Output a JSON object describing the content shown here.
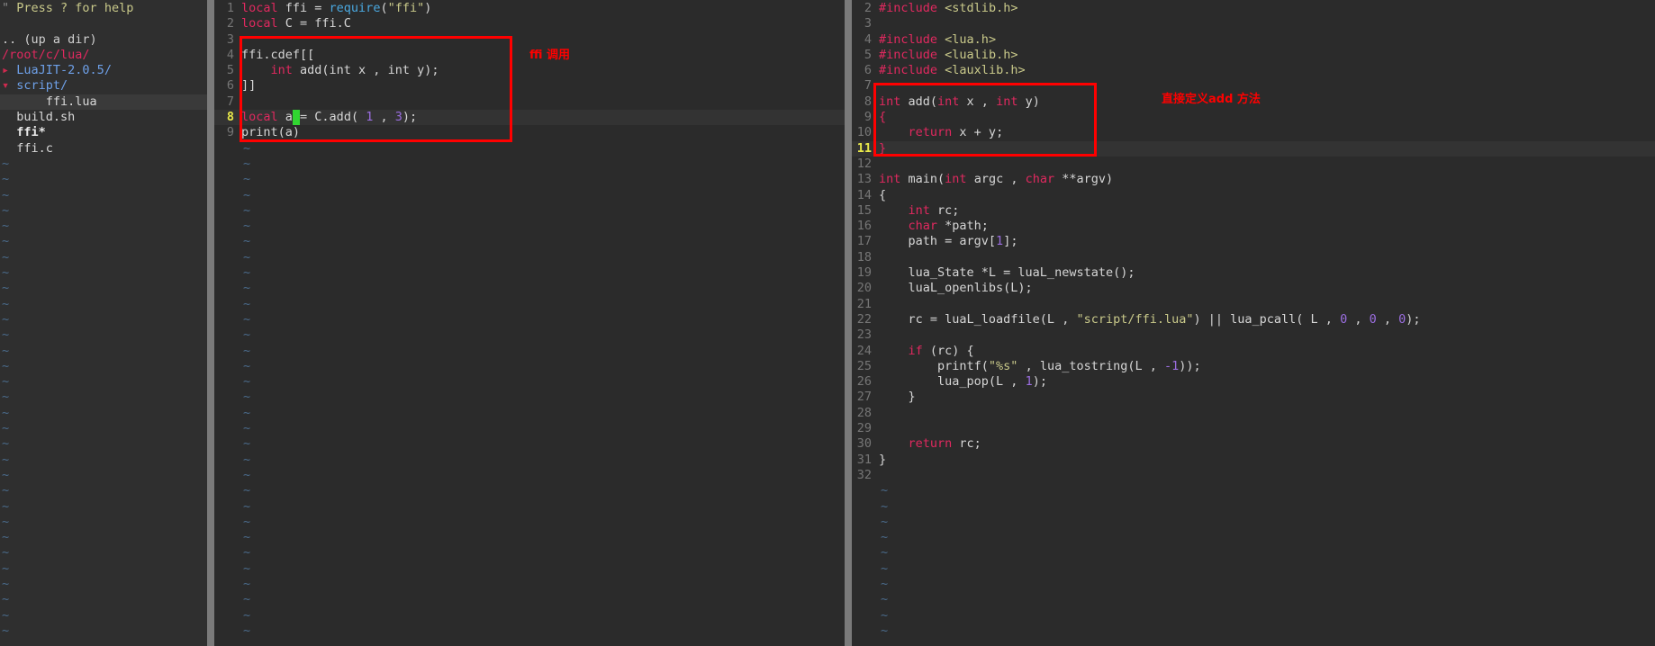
{
  "window": {
    "background": "#2b2b2b",
    "accent_red": "#ff0000"
  },
  "sidebar": {
    "name": "nerdtree-file-explorer",
    "help_prefix": "\"",
    "help_text": "Press ? for help",
    "up_dir": ".. (up a dir)",
    "cwd_path": "/root/c/lua/",
    "items": [
      {
        "indent": 0,
        "arrow": "▸",
        "label": "LuaJIT-2.0.5/",
        "type": "dir-closed",
        "selected": false
      },
      {
        "indent": 0,
        "arrow": "▾",
        "label": "script/",
        "type": "dir-open",
        "selected": false
      },
      {
        "indent": 1,
        "arrow": "",
        "label": "ffi.lua",
        "type": "file",
        "selected": true
      },
      {
        "indent": 0,
        "arrow": "",
        "label": "build.sh",
        "type": "file",
        "selected": false
      },
      {
        "indent": 0,
        "arrow": "",
        "label": "ffi*",
        "type": "executable",
        "selected": false
      },
      {
        "indent": 0,
        "arrow": "",
        "label": "ffi.c",
        "type": "file",
        "selected": false
      }
    ],
    "tilde": "~"
  },
  "left_pane": {
    "name": "ffi-lua-editor",
    "cursor_line": 8,
    "lines": [
      {
        "n": 1,
        "tokens": [
          {
            "t": "local",
            "c": "kw"
          },
          {
            "t": " ffi = ",
            "c": "pl"
          },
          {
            "t": "require",
            "c": "fn"
          },
          {
            "t": "(",
            "c": "pl"
          },
          {
            "t": "\"ffi\"",
            "c": "str"
          },
          {
            "t": ")",
            "c": "pl"
          }
        ]
      },
      {
        "n": 2,
        "tokens": [
          {
            "t": "local",
            "c": "kw"
          },
          {
            "t": " C = ffi.C",
            "c": "pl"
          }
        ]
      },
      {
        "n": 3,
        "tokens": []
      },
      {
        "n": 4,
        "tokens": [
          {
            "t": "ffi.cdef[[",
            "c": "pl"
          }
        ]
      },
      {
        "n": 5,
        "tokens": [
          {
            "t": "    ",
            "c": "pl"
          },
          {
            "t": "int",
            "c": "kw"
          },
          {
            "t": " add(int x , int y);",
            "c": "pl"
          }
        ]
      },
      {
        "n": 6,
        "tokens": [
          {
            "t": "]]",
            "c": "pl"
          }
        ]
      },
      {
        "n": 7,
        "tokens": []
      },
      {
        "n": 8,
        "tokens": [
          {
            "t": "local",
            "c": "kw"
          },
          {
            "t": " a",
            "c": "pl"
          },
          {
            "t": " ",
            "c": "cursor"
          },
          {
            "t": "= C.add( ",
            "c": "pl"
          },
          {
            "t": "1",
            "c": "num"
          },
          {
            "t": " , ",
            "c": "pl"
          },
          {
            "t": "3",
            "c": "num"
          },
          {
            "t": ");",
            "c": "pl"
          }
        ]
      },
      {
        "n": 9,
        "tokens": [
          {
            "t": "print(a)",
            "c": "pl"
          }
        ]
      }
    ],
    "annotation": "ffi 调用"
  },
  "right_pane": {
    "name": "ffi-c-editor",
    "cursor_line": 11,
    "first_visible_line": 2,
    "lines": [
      {
        "n": 2,
        "tokens": [
          {
            "t": "#include",
            "c": "pp"
          },
          {
            "t": " ",
            "c": "pl"
          },
          {
            "t": "<stdlib.h>",
            "c": "hdr"
          }
        ]
      },
      {
        "n": 3,
        "tokens": []
      },
      {
        "n": 4,
        "tokens": [
          {
            "t": "#include",
            "c": "pp"
          },
          {
            "t": " ",
            "c": "pl"
          },
          {
            "t": "<lua.h>",
            "c": "hdr"
          }
        ]
      },
      {
        "n": 5,
        "tokens": [
          {
            "t": "#include",
            "c": "pp"
          },
          {
            "t": " ",
            "c": "pl"
          },
          {
            "t": "<lualib.h>",
            "c": "hdr"
          }
        ]
      },
      {
        "n": 6,
        "tokens": [
          {
            "t": "#include",
            "c": "pp"
          },
          {
            "t": " ",
            "c": "pl"
          },
          {
            "t": "<lauxlib.h>",
            "c": "hdr"
          }
        ]
      },
      {
        "n": 7,
        "tokens": []
      },
      {
        "n": 8,
        "tokens": [
          {
            "t": "int",
            "c": "kw"
          },
          {
            "t": " add(",
            "c": "pl"
          },
          {
            "t": "int",
            "c": "kw"
          },
          {
            "t": " x , ",
            "c": "pl"
          },
          {
            "t": "int",
            "c": "kw"
          },
          {
            "t": " y)",
            "c": "pl"
          }
        ]
      },
      {
        "n": 9,
        "tokens": [
          {
            "t": "{",
            "c": "kw"
          }
        ]
      },
      {
        "n": 10,
        "tokens": [
          {
            "t": "    ",
            "c": "pl"
          },
          {
            "t": "return",
            "c": "kw"
          },
          {
            "t": " x + y;",
            "c": "pl"
          }
        ]
      },
      {
        "n": 11,
        "tokens": [
          {
            "t": "}",
            "c": "kw"
          }
        ]
      },
      {
        "n": 12,
        "tokens": []
      },
      {
        "n": 13,
        "tokens": [
          {
            "t": "int",
            "c": "kw"
          },
          {
            "t": " main(",
            "c": "pl"
          },
          {
            "t": "int",
            "c": "kw"
          },
          {
            "t": " argc , ",
            "c": "pl"
          },
          {
            "t": "char",
            "c": "kw"
          },
          {
            "t": " **argv)",
            "c": "pl"
          }
        ]
      },
      {
        "n": 14,
        "tokens": [
          {
            "t": "{",
            "c": "pl"
          }
        ]
      },
      {
        "n": 15,
        "tokens": [
          {
            "t": "    ",
            "c": "pl"
          },
          {
            "t": "int",
            "c": "kw"
          },
          {
            "t": " rc;",
            "c": "pl"
          }
        ]
      },
      {
        "n": 16,
        "tokens": [
          {
            "t": "    ",
            "c": "pl"
          },
          {
            "t": "char",
            "c": "kw"
          },
          {
            "t": " *path;",
            "c": "pl"
          }
        ]
      },
      {
        "n": 17,
        "tokens": [
          {
            "t": "    path = argv[",
            "c": "pl"
          },
          {
            "t": "1",
            "c": "num"
          },
          {
            "t": "];",
            "c": "pl"
          }
        ]
      },
      {
        "n": 18,
        "tokens": []
      },
      {
        "n": 19,
        "tokens": [
          {
            "t": "    lua_State *L = luaL_newstate();",
            "c": "pl"
          }
        ]
      },
      {
        "n": 20,
        "tokens": [
          {
            "t": "    luaL_openlibs(L);",
            "c": "pl"
          }
        ]
      },
      {
        "n": 21,
        "tokens": []
      },
      {
        "n": 22,
        "tokens": [
          {
            "t": "    rc = luaL_loadfile(L , ",
            "c": "pl"
          },
          {
            "t": "\"script/ffi.lua\"",
            "c": "str"
          },
          {
            "t": ") || lua_pcall( L , ",
            "c": "pl"
          },
          {
            "t": "0",
            "c": "num"
          },
          {
            "t": " , ",
            "c": "pl"
          },
          {
            "t": "0",
            "c": "num"
          },
          {
            "t": " , ",
            "c": "pl"
          },
          {
            "t": "0",
            "c": "num"
          },
          {
            "t": ");",
            "c": "pl"
          }
        ]
      },
      {
        "n": 23,
        "tokens": []
      },
      {
        "n": 24,
        "tokens": [
          {
            "t": "    ",
            "c": "pl"
          },
          {
            "t": "if",
            "c": "kw"
          },
          {
            "t": " (rc) {",
            "c": "pl"
          }
        ]
      },
      {
        "n": 25,
        "tokens": [
          {
            "t": "        printf(",
            "c": "pl"
          },
          {
            "t": "\"%s\"",
            "c": "str"
          },
          {
            "t": " , lua_tostring(L , ",
            "c": "pl"
          },
          {
            "t": "-1",
            "c": "num"
          },
          {
            "t": "));",
            "c": "pl"
          }
        ]
      },
      {
        "n": 26,
        "tokens": [
          {
            "t": "        lua_pop(L , ",
            "c": "pl"
          },
          {
            "t": "1",
            "c": "num"
          },
          {
            "t": ");",
            "c": "pl"
          }
        ]
      },
      {
        "n": 27,
        "tokens": [
          {
            "t": "    }",
            "c": "pl"
          }
        ]
      },
      {
        "n": 28,
        "tokens": []
      },
      {
        "n": 29,
        "tokens": []
      },
      {
        "n": 30,
        "tokens": [
          {
            "t": "    ",
            "c": "pl"
          },
          {
            "t": "return",
            "c": "kw"
          },
          {
            "t": " rc;",
            "c": "pl"
          }
        ]
      },
      {
        "n": 31,
        "tokens": [
          {
            "t": "}",
            "c": "pl"
          }
        ]
      },
      {
        "n": 32,
        "tokens": []
      }
    ],
    "annotation": "直接定义add 方法"
  }
}
